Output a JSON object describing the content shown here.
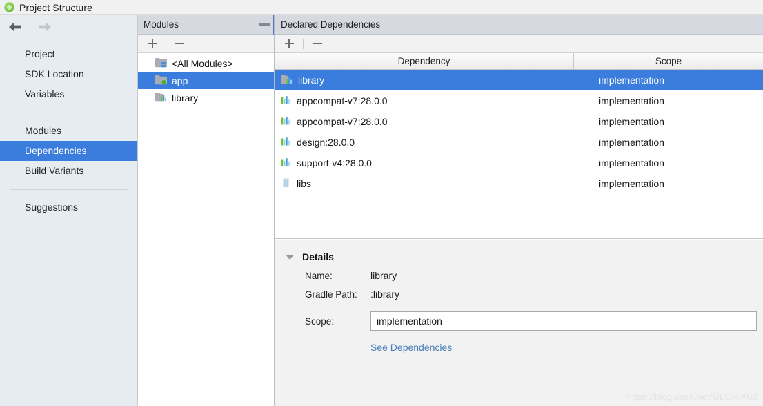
{
  "window": {
    "title": "Project Structure",
    "icon": "android-studio-icon"
  },
  "nav": {
    "back_icon": "arrow-left-icon",
    "forward_icon": "arrow-right-icon"
  },
  "sidebar": {
    "groups": [
      {
        "items": [
          {
            "label": "Project",
            "selected": false
          },
          {
            "label": "SDK Location",
            "selected": false
          },
          {
            "label": "Variables",
            "selected": false
          }
        ]
      },
      {
        "items": [
          {
            "label": "Modules",
            "selected": false
          },
          {
            "label": "Dependencies",
            "selected": true
          },
          {
            "label": "Build Variants",
            "selected": false
          }
        ]
      },
      {
        "items": [
          {
            "label": "Suggestions",
            "selected": false
          }
        ]
      }
    ]
  },
  "modules_panel": {
    "title": "Modules",
    "collapse_icon": "collapse-icon",
    "toolbar": [
      {
        "name": "add-module-button",
        "icon": "plus-icon"
      },
      {
        "name": "remove-module-button",
        "icon": "minus-icon"
      }
    ],
    "items": [
      {
        "label": "<All Modules>",
        "icon": "all-modules-folder-icon",
        "selected": false
      },
      {
        "label": "app",
        "icon": "app-module-folder-icon",
        "selected": true
      },
      {
        "label": "library",
        "icon": "library-module-icon",
        "selected": false
      }
    ]
  },
  "dependencies_panel": {
    "title": "Declared Dependencies",
    "toolbar": [
      {
        "name": "add-dependency-button",
        "icon": "plus-icon"
      },
      {
        "name": "remove-dependency-button",
        "icon": "minus-icon"
      }
    ],
    "columns": [
      "Dependency",
      "Scope"
    ],
    "rows": [
      {
        "dependency": "library",
        "scope": "implementation",
        "icon": "library-module-icon",
        "selected": true
      },
      {
        "dependency": "appcompat-v7:28.0.0",
        "scope": "implementation",
        "icon": "artifact-library-icon",
        "selected": false
      },
      {
        "dependency": "appcompat-v7:28.0.0",
        "scope": "implementation",
        "icon": "artifact-library-icon",
        "selected": false
      },
      {
        "dependency": "design:28.0.0",
        "scope": "implementation",
        "icon": "artifact-library-icon",
        "selected": false
      },
      {
        "dependency": "support-v4:28.0.0",
        "scope": "implementation",
        "icon": "artifact-library-icon",
        "selected": false
      },
      {
        "dependency": "libs",
        "scope": "implementation",
        "icon": "jar-folder-icon",
        "selected": false
      }
    ]
  },
  "details": {
    "title": "Details",
    "caret_icon": "chevron-down-icon",
    "name_label": "Name:",
    "name_value": "library",
    "gradle_path_label": "Gradle Path:",
    "gradle_path_value": ":library",
    "scope_label": "Scope:",
    "scope_value": "implementation",
    "see_dependencies_link": "See Dependencies"
  },
  "watermark": "https://blog.csdn.net/GLORIA00",
  "colors": {
    "accent": "#3b7ddd",
    "sidebar_bg": "#e7ecf0",
    "panel_header_bg": "#d6dae0",
    "link": "#4a7ebb"
  }
}
